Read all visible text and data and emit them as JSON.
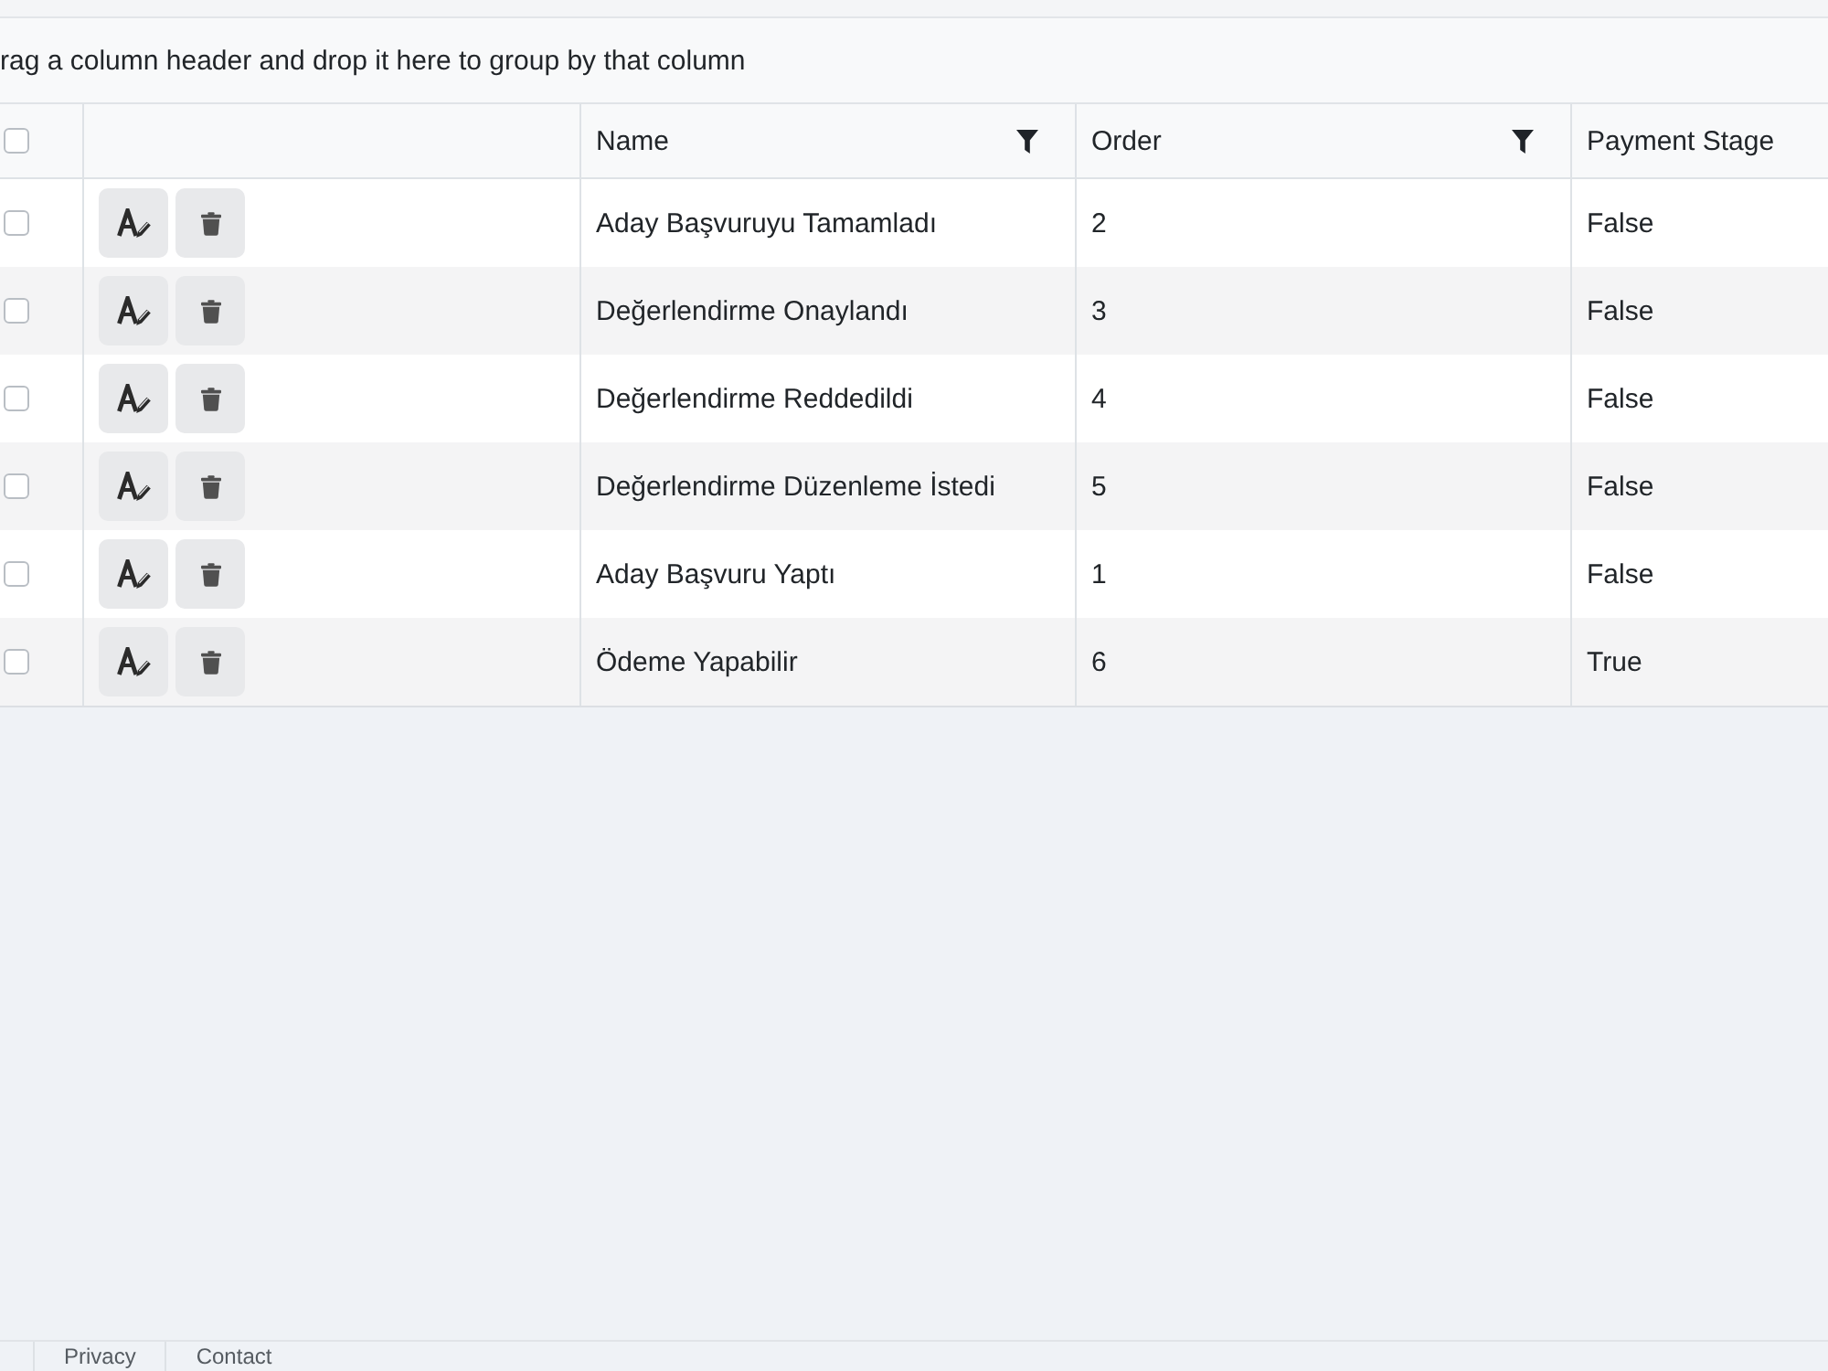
{
  "group_panel": {
    "hint": "rag a column header and drop it here to group by that column"
  },
  "table": {
    "header_checkbox": {
      "checked": false
    },
    "columns": [
      {
        "label": "Name",
        "filter": true
      },
      {
        "label": "Order",
        "filter": true
      },
      {
        "label": "Payment Stage",
        "filter": false
      }
    ],
    "rows": [
      {
        "checked": false,
        "name": "Aday Başvuruyu Tamamladı",
        "order": "2",
        "payment_stage": "False"
      },
      {
        "checked": false,
        "name": "Değerlendirme Onaylandı",
        "order": "3",
        "payment_stage": "False"
      },
      {
        "checked": false,
        "name": "Değerlendirme Reddedildi",
        "order": "4",
        "payment_stage": "False"
      },
      {
        "checked": false,
        "name": "Değerlendirme Düzenleme İstedi",
        "order": "5",
        "payment_stage": "False"
      },
      {
        "checked": false,
        "name": "Aday Başvuru Yaptı",
        "order": "1",
        "payment_stage": "False"
      },
      {
        "checked": false,
        "name": "Ödeme Yapabilir",
        "order": "6",
        "payment_stage": "True"
      }
    ]
  },
  "footer": {
    "links": [
      "Privacy",
      "Contact"
    ]
  }
}
